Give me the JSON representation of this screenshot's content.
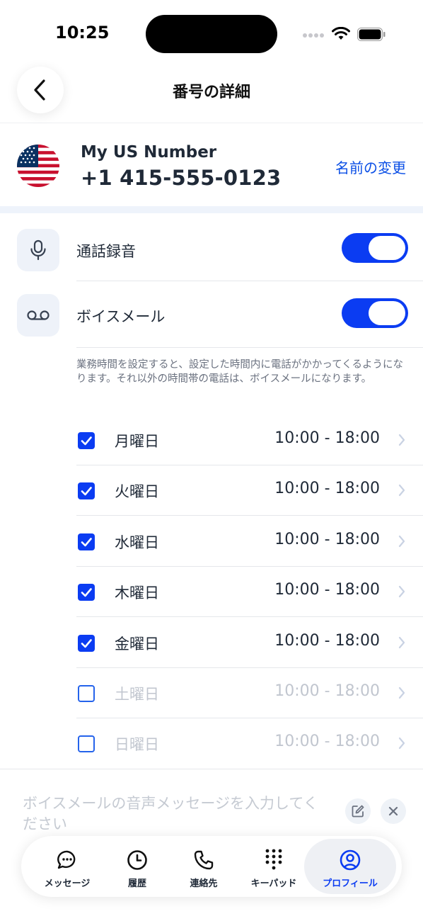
{
  "status_bar": {
    "time": "10:25"
  },
  "header": {
    "title": "番号の詳細"
  },
  "number": {
    "name": "My US Number",
    "value": "+1 415-555-0123",
    "rename_label": "名前の変更",
    "flag_icon": "us-flag-icon"
  },
  "settings": {
    "recording": {
      "label": "通話録音",
      "enabled": true,
      "icon": "microphone-icon"
    },
    "voicemail": {
      "label": "ボイスメール",
      "enabled": true,
      "icon": "voicemail-icon"
    },
    "note": "業務時間を設定すると、設定した時間内に電話がかかってくるようになります。それ以外の時間帯の電話は、ボイスメールになります。"
  },
  "schedule": [
    {
      "day": "月曜日",
      "hours": "10:00 - 18:00",
      "checked": true
    },
    {
      "day": "火曜日",
      "hours": "10:00 - 18:00",
      "checked": true
    },
    {
      "day": "水曜日",
      "hours": "10:00 - 18:00",
      "checked": true
    },
    {
      "day": "木曜日",
      "hours": "10:00 - 18:00",
      "checked": true
    },
    {
      "day": "金曜日",
      "hours": "10:00 - 18:00",
      "checked": true
    },
    {
      "day": "土曜日",
      "hours": "10:00 - 18:00",
      "checked": false
    },
    {
      "day": "日曜日",
      "hours": "10:00 - 18:00",
      "checked": false
    }
  ],
  "voicemail_message": {
    "placeholder": "ボイスメールの音声メッセージを入力してください"
  },
  "tabs": [
    {
      "label": "メッセージ",
      "icon": "chat-bubble-icon"
    },
    {
      "label": "履歴",
      "icon": "clock-icon"
    },
    {
      "label": "連絡先",
      "icon": "phone-icon"
    },
    {
      "label": "キーパッド",
      "icon": "keypad-icon"
    },
    {
      "label": "プロフィール",
      "icon": "profile-icon",
      "active": true
    }
  ],
  "colors": {
    "accent": "#0b3cf2",
    "link": "#0b4fe6",
    "disabled_text": "#c1c6cf"
  }
}
